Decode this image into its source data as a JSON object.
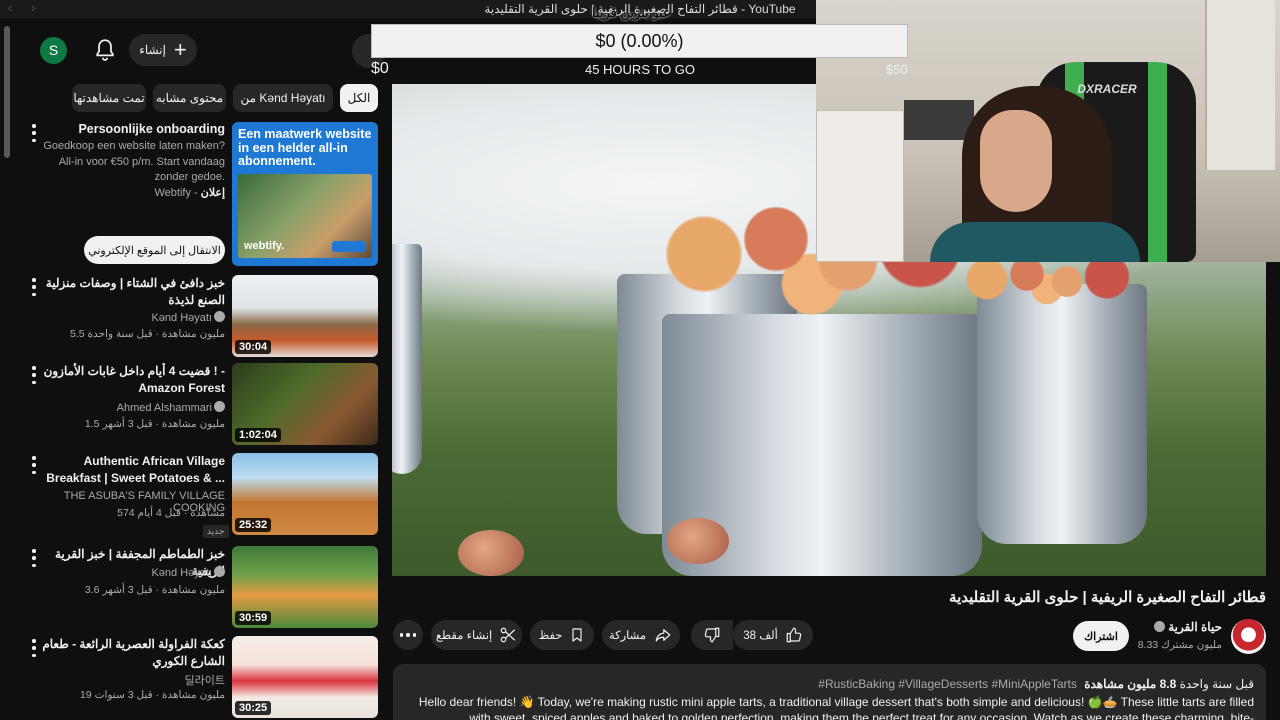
{
  "window": {
    "title": "قطائر التفاح الصغيرة الريفية | حلوى القرية التقليدية - YouTube",
    "nav": "‹ ›"
  },
  "header": {
    "avatar_letter": "S",
    "create_label": "إنشاء"
  },
  "chips": [
    {
      "label": "الكل",
      "active": true
    },
    {
      "label": "من Kənd Həyatı",
      "active": false
    },
    {
      "label": "محتوى مشابه",
      "active": false
    },
    {
      "label": "تمت مشاهدتها",
      "active": false
    }
  ],
  "ad": {
    "title": "Persoonlijke onboarding",
    "description": "Goedkoop een website laten maken? All-in voor €50 p/m. Start vandaag zonder gedoe.",
    "advertiser": "Webtify",
    "ad_label": "إعلان",
    "thumb_text": "Een maatwerk website in een helder all-in abonnement.",
    "thumb_brand": "webtify.",
    "cta": "الانتقال إلى الموقع الإلكتروني"
  },
  "side_videos": [
    {
      "title": "خبز دافئ في الشتاء | وصفات منزلية الصنع لذيذة",
      "channel": "Kənd Həyatı",
      "meta": "5.5 مليون مشاهدة · قبل سنة واحدة",
      "duration": "30:04",
      "thumb": "linear-gradient(180deg,#eef1f3 0%,#dfe4e6 40%,#8a6b4a 60%,#c65a2a 80%,#e2dcd6 100%)"
    },
    {
      "title": "قضيت 4 أيام داخل غابات الأمازون ! - Amazon Forest",
      "channel": "Ahmed Alshammari",
      "meta": "1.5 مليون مشاهدة · قبل 3 أشهر",
      "duration": "1:02:04",
      "thumb": "linear-gradient(135deg,#2c3d1d 0%,#4f6b2a 40%,#8a5a32 70%,#3a2a1a 100%)"
    },
    {
      "title": "Authentic African Village Breakfast | Sweet Potatoes & ...",
      "channel": "THE ASUBA'S FAMILY VILLAGE COOKING",
      "meta": "574 مشاهدة · قبل 4 أيام",
      "new_badge": "جديد",
      "duration": "25:32",
      "thumb": "linear-gradient(180deg,#8ac0e6 0%,#bfdcf0 30%,#c0762f 60%,#d18a42 100%)"
    },
    {
      "title": "خبز الطماطم المجففة | خبز القرية الريفية",
      "channel": "Kənd Həyatı",
      "meta": "3.6 مليون مشاهدة · قبل 3 أشهر",
      "duration": "30:59",
      "thumb": "linear-gradient(180deg,#3f7a3a 0%,#6ea04a 35%,#e49a44 60%,#4a8a3a 100%)"
    },
    {
      "title": "كعكة الفراولة العصرية الرائعة - طعام الشارع الكوري",
      "channel": "딜라이트",
      "meta": "19 مليون مشاهدة · قبل 3 سنوات",
      "duration": "30:25",
      "thumb": "linear-gradient(180deg,#f4eee8 0%,#f7e2dc 35%,#d9343c 55%,#f3ece6 75%,#e9e2dc 100%)"
    }
  ],
  "goal": {
    "label": "عبو بنزين قريبا",
    "amount": "$0 (0.00%)",
    "progress": 0,
    "min": "$0",
    "max": "$50",
    "time_left": "45 HOURS TO GO"
  },
  "webcam": {
    "chair_brand": "DXRACER"
  },
  "video": {
    "title": "قطائر التفاح الصغيرة الريفية | حلوى القرية التقليدية",
    "channel": "حياة القرية",
    "subscribers": "8.33 مليون مشترك",
    "subscribe": "اشتراك",
    "likes": "38 ألف",
    "share": "مشاركة",
    "save": "حفظ",
    "clip": "إنشاء مقطع",
    "views": "8.8 مليون مشاهدة",
    "age": "قبل سنة واحدة",
    "hashtags": "#RusticBaking #VillageDesserts #MiniAppleTarts",
    "description": "Hello dear friends! 👋 Today, we're making rustic mini apple tarts, a traditional village dessert that's both simple and delicious! 🍏🥧 These little tarts are filled with sweet, spiced apples and baked to golden perfection, making them the perfect treat for any occasion. Watch as we create these charming, bite-"
  },
  "colors": {
    "background": "#0f0f0f",
    "surface": "#272727",
    "text": "#f1f1f1",
    "muted": "#aaaaaa",
    "avatar": "#0e7a43",
    "ad_blue": "#1f78d4"
  }
}
